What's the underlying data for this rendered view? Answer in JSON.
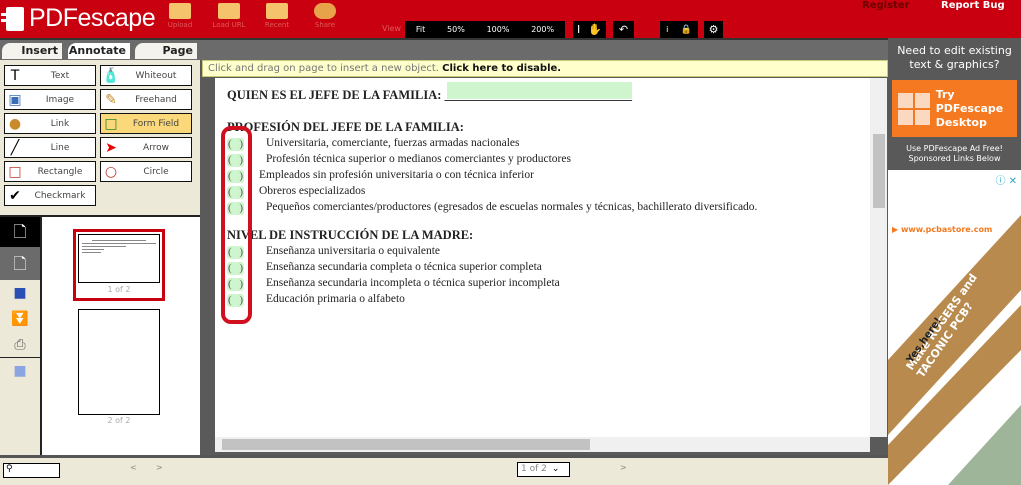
{
  "header": {
    "logo": "PDFescape",
    "toolbar": [
      {
        "label": "Upload",
        "icon": "upload-folder-icon"
      },
      {
        "label": "Load URL",
        "icon": "load-url-folder-icon"
      },
      {
        "label": "Recent",
        "icon": "recent-folder-icon"
      },
      {
        "label": "Share",
        "icon": "share-users-icon"
      }
    ],
    "view_label": "View",
    "zoom_options": [
      "Fit",
      "50%",
      "100%",
      "200%"
    ],
    "register": "Register",
    "report_bug": "Report Bug"
  },
  "tabs": [
    "Insert",
    "Annotate",
    "Page"
  ],
  "tools": [
    {
      "label": "Text",
      "icon": "T"
    },
    {
      "label": "Whiteout",
      "icon": "🧴"
    },
    {
      "label": "Image",
      "icon": "▣"
    },
    {
      "label": "Freehand",
      "icon": "✎"
    },
    {
      "label": "Link",
      "icon": "●"
    },
    {
      "label": "Form Field",
      "icon": "□"
    },
    {
      "label": "Line",
      "icon": "╱"
    },
    {
      "label": "Arrow",
      "icon": "➤"
    },
    {
      "label": "Rectangle",
      "icon": "□"
    },
    {
      "label": "Circle",
      "icon": "○"
    },
    {
      "label": "Checkmark",
      "icon": "✔"
    }
  ],
  "thumbnails": [
    "1 of 2",
    "2 of 2"
  ],
  "notice": {
    "text": "Click and drag on page to insert a new object. ",
    "link": "Click here to disable."
  },
  "document": {
    "title": "QUIEN ES EL JEFE DE LA FAMILIA: ______________________________",
    "section1": "PROFESIÓN DEL JEFE DE LA FAMILIA:",
    "items1": [
      "Universitaria, comerciante, fuerzas armadas nacionales",
      "Profesión técnica superior o medianos comerciantes y productores",
      "Empleados sin profesión universitaria o con técnica inferior",
      "Obreros especializados",
      "Pequeños comerciantes/productores (egresados de escuelas normales y técnicas, bachillerato   diversificado."
    ],
    "section2": "NIVEL DE INSTRUCCIÓN DE LA MADRE:",
    "items2": [
      "Enseñanza universitaria o equivalente",
      "Enseñanza secundaria completa o técnica superior completa",
      "Enseñanza secundaria incompleta o técnica superior incompleta",
      "Educación primaria o alfabeto"
    ]
  },
  "bottom": {
    "page_select": "1 of 2",
    "prev": "<",
    "next": ">"
  },
  "ad": {
    "headline": "Need to edit existing text & graphics?",
    "cta": "Try PDFescape Desktop",
    "sub": "Use PDFescape Ad Free! Sponsored Links Below",
    "url": "www.pcbastore.com",
    "banner1": "Make ROGERS and TACONIC PCB?",
    "banner2": "Yes,here!"
  },
  "colors": {
    "brand": "#c8000f",
    "accent": "#f47920",
    "notice": "#ffffcc",
    "field": "#cff5cf"
  }
}
